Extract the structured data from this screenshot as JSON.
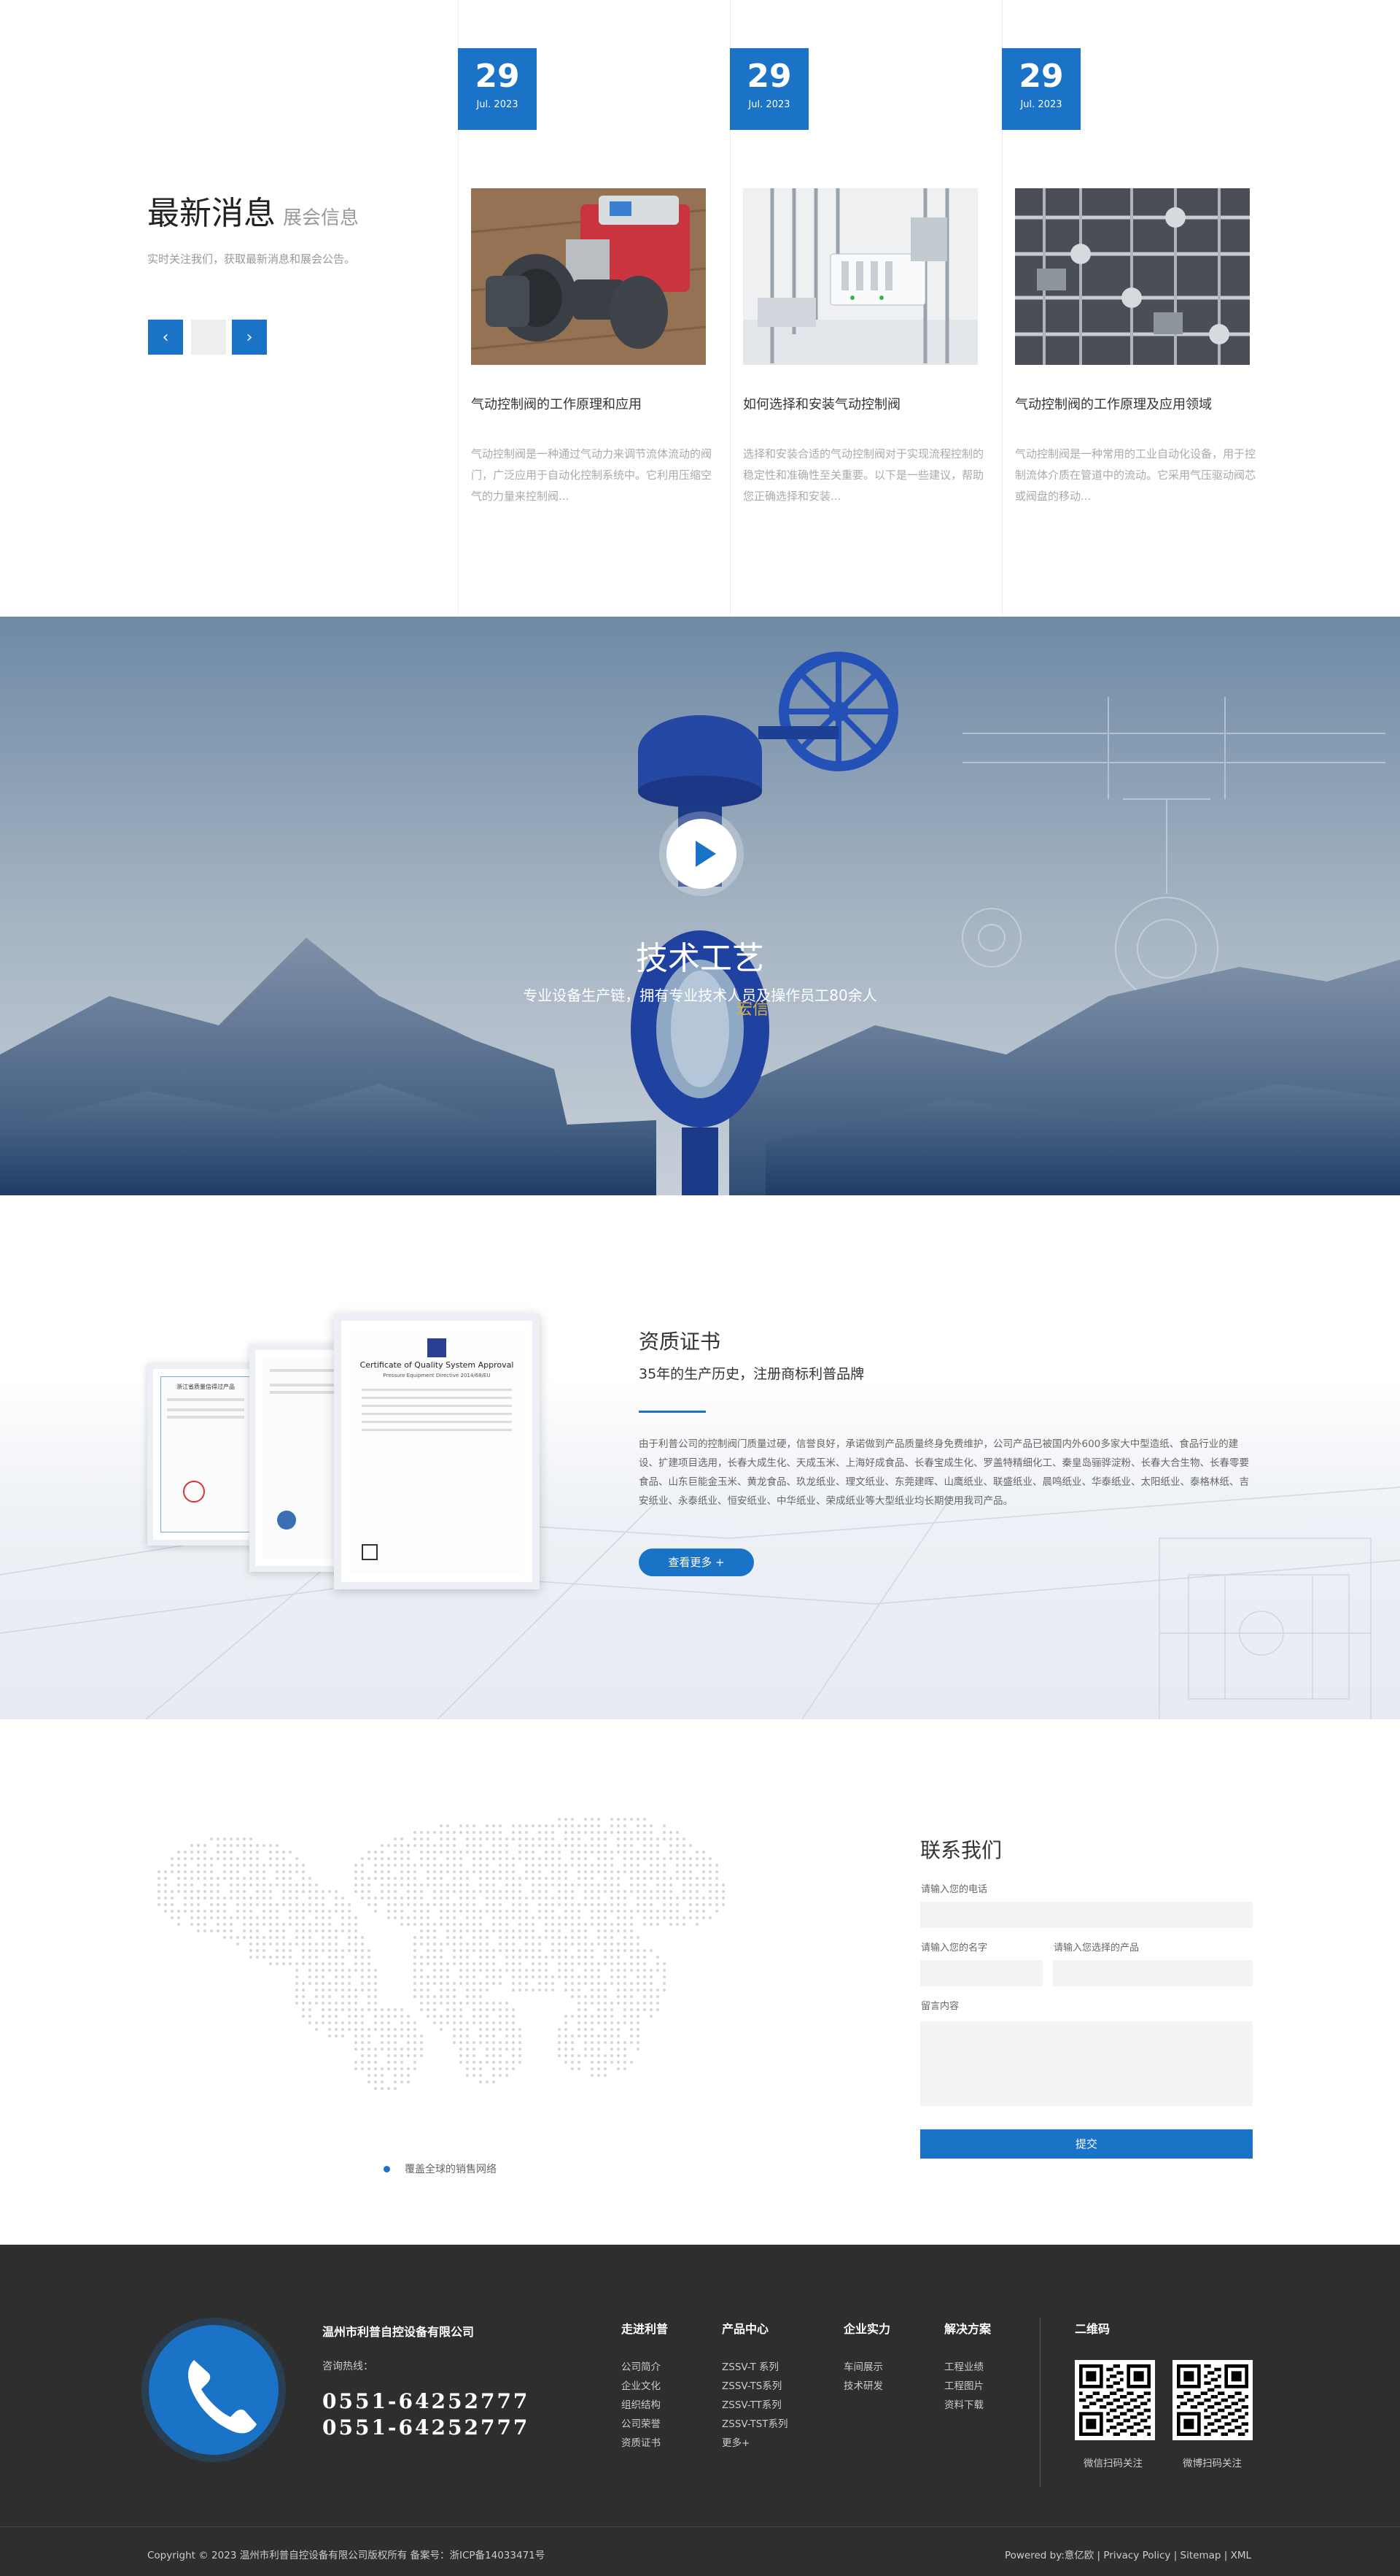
{
  "news": {
    "title": "最新消息",
    "title_sub": "展会信息",
    "desc": "实时关注我们，获取最新消息和展会公告。",
    "prev_icon": "‹",
    "next_icon": "›",
    "items": [
      {
        "day": "29",
        "month": "Jul. 2023",
        "title": "气动控制阀的工作原理和应用",
        "text": "气动控制阀是一种通过气动力来调节流体流动的阀门，广泛应用于自动化控制系统中。它利用压缩空气的力量来控制阀..."
      },
      {
        "day": "29",
        "month": "Jul. 2023",
        "title": "如何选择和安装气动控制阀",
        "text": "选择和安装合适的气动控制阀对于实现流程控制的稳定性和准确性至关重要。以下是一些建议，帮助您正确选择和安装..."
      },
      {
        "day": "29",
        "month": "Jul. 2023",
        "title": "气动控制阀的工作原理及应用领域",
        "text": "气动控制阀是一种常用的工业自动化设备，用于控制流体介质在管道中的流动。它采用气压驱动阀芯或阀盘的移动..."
      }
    ]
  },
  "video": {
    "title": "技术工艺",
    "subtitle": "专业设备生产链，拥有专业技术人员及操作员工80余人",
    "valve_brand": "宏信"
  },
  "cert": {
    "title": "资质证书",
    "subtitle": "35年的生产历史，注册商标利普品牌",
    "text": "由于利普公司的控制阀门质量过硬，信誉良好，承诺做到产品质量终身免费维护，公司产品已被国内外600多家大中型造纸、食品行业的建设、扩建项目选用，长春大成生化、天成玉米、上海好成食品、长春宝成生化、罗盖特精细化工、秦皇岛骊骅淀粉、长春大合生物、长春零要食品、山东巨能金玉米、黄龙食品、玖龙纸业、理文纸业、东莞建晖、山鹰纸业、联盛纸业、晨鸣纸业、华泰纸业、太阳纸业、泰格林纸、吉安纸业、永泰纸业、恒安纸业、中华纸业、荣成纸业等大型纸业均长期使用我司产品。",
    "more": "查看更多 +",
    "cert1_title": "浙江省质量信得过产品",
    "cert3_title": "Certificate of Quality System Approval",
    "cert3_sub": "Pressure Equipment Directive 2014/68/EU"
  },
  "contact": {
    "title": "联系我们",
    "phone_label": "请输入您的电话",
    "name_label": "请输入您的名字",
    "product_label": "请输入您选择的产品",
    "message_label": "留言内容",
    "submit": "提交",
    "map_legend": "覆盖全球的销售网络"
  },
  "footer": {
    "company": "温州市利普自控设备有限公司",
    "hotline_label": "咨询热线：",
    "phone1": "0551-64252777",
    "phone2": "0551-64252777",
    "columns": [
      {
        "title": "走进利普",
        "links": [
          "公司简介",
          "企业文化",
          "组织结构",
          "公司荣誉",
          "资质证书"
        ]
      },
      {
        "title": "产品中心",
        "links": [
          "ZSSV-T 系列",
          "ZSSV-TS系列",
          "ZSSV-TT系列",
          "ZSSV-TST系列",
          "更多+"
        ]
      },
      {
        "title": "企业实力",
        "links": [
          "车间展示",
          "技术研发"
        ]
      },
      {
        "title": "解决方案",
        "links": [
          "工程业绩",
          "工程图片",
          "资料下载"
        ]
      }
    ],
    "qr_title": "二维码",
    "qr1_caption": "微信扫码关注",
    "qr2_caption": "微博扫码关注",
    "copyright": "Copyright © 2023 温州市利普自控设备有限公司版权所有 备案号：浙ICP备14033471号",
    "powered": "Powered by:意亿欧 | Privacy Policy | Sitemap | XML"
  },
  "colors": {
    "accent": "#1a73c6",
    "footer_bg": "#2e2e2e"
  }
}
